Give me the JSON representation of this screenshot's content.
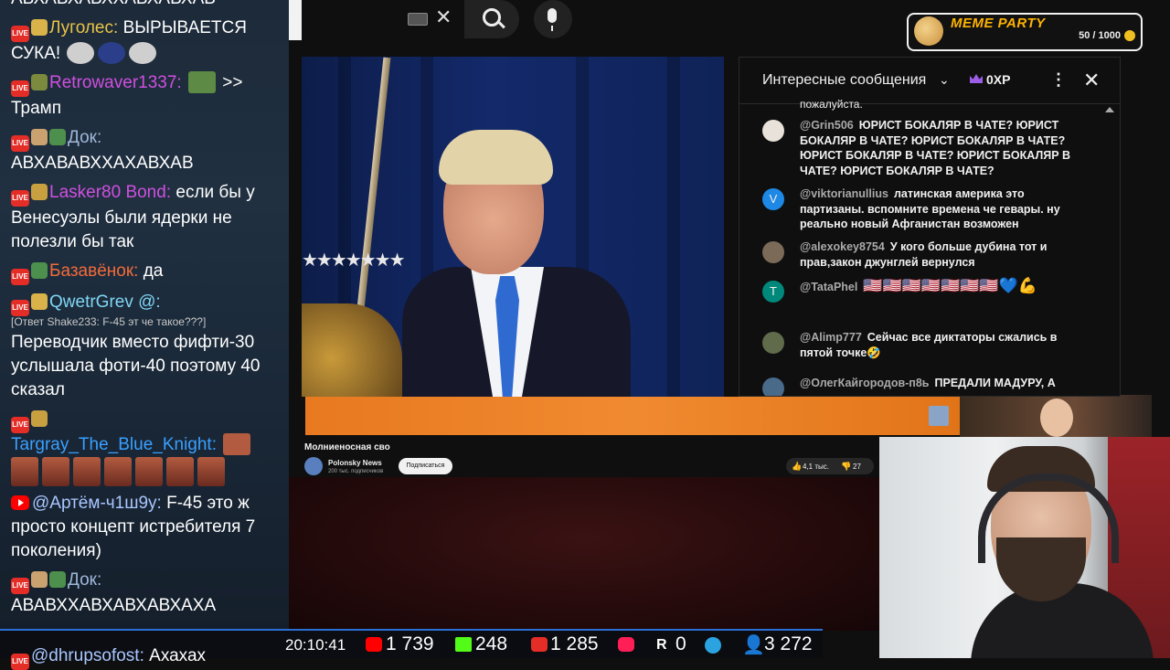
{
  "stream_chat": {
    "top_clipped": "АВХАВХАВХХАВХАВХАВ",
    "messages": [
      {
        "nick": "Луголес:",
        "nick_color": "#e8c547",
        "text": "ВЫРЫВАЕТСЯ СУКА!"
      },
      {
        "nick": "Retrowaver1337:",
        "nick_color": "#d04fe0",
        "text": ">> Трамп"
      },
      {
        "nick": "Док:",
        "nick_color": "#9fb7d8",
        "text": "АВХАВАВХХАХАВХАВ"
      },
      {
        "nick": "Lasker80 Bond:",
        "nick_color": "#d04fe0",
        "text": "если бы у Венесуэлы были ядерки не полезли бы так"
      },
      {
        "nick": "Базавёнок:",
        "nick_color": "#f36b3a",
        "text": "да"
      },
      {
        "nick": "QwetrGrev",
        "nick_color": "#7fd6f4",
        "text": "@:"
      },
      {
        "reply": "[Ответ Shake233: F-45 эт че такое???]",
        "text": "Переводчик вместо фифти-30 услышала фоти-40 поэтому 40 сказал"
      },
      {
        "nick": "Targray_The_Blue_Knight:",
        "nick_color": "#3aa0ff",
        "text": ""
      },
      {
        "nick": "@Артём-ч1ш9у:",
        "nick_color": "#a9c6ff",
        "text": "F-45 это ж просто концепт истребителя 7 поколения)"
      },
      {
        "nick": "Док:",
        "nick_color": "#9fb7d8",
        "text": "АВАВХХАВХАВХАВХАХА"
      }
    ],
    "bottom_clipped_nick": "@dhrupsofost:",
    "bottom_clipped_text": "Ахахах"
  },
  "yt_header": {
    "clear_label": "✕"
  },
  "meme_party": {
    "title": "MEME PARTY",
    "score": "50 / 1000"
  },
  "video": {
    "title": "Молниеносная сво",
    "channel": "Polonsky News",
    "subscribers": "200 тыс. подписчиков",
    "subscribe_label": "Подписаться",
    "likes": "4,1 тыс.",
    "dislikes": "27"
  },
  "yt_chat": {
    "mode": "Интересные сообщения",
    "xp": "0XP",
    "clipped_top": "пожалуйста.",
    "messages": [
      {
        "author": "@Grin506",
        "text": "ЮРИСТ БОКАЛЯР В ЧАТЕ? ЮРИСТ БОКАЛЯР В ЧАТЕ? ЮРИСТ БОКАЛЯР В ЧАТЕ? ЮРИСТ БОКАЛЯР В ЧАТЕ? ЮРИСТ БОКАЛЯР В ЧАТЕ? ЮРИСТ БОКАЛЯР В ЧАТЕ?",
        "avatar": "#e9e2da",
        "initial": ""
      },
      {
        "author": "@viktorianullius",
        "text": "латинская америка это партизаны. вспомните времена че гевары. ну реально новый Афганистан возможен",
        "avatar": "#1e88e5",
        "initial": "V"
      },
      {
        "author": "@alexokey8754",
        "text": "У кого больше дубина тот и прав,закон джунглей вернулся",
        "avatar": "#7c6a58",
        "initial": ""
      },
      {
        "author": "@TataPhel",
        "text": "🇺🇸🇺🇸🇺🇸🇺🇸🇺🇸🇺🇸🇺🇸💙💪",
        "avatar": "#00897b",
        "initial": "T"
      },
      {
        "author": "@Alimp777",
        "text": "Сейчас все диктаторы сжались в пятой точке🤣",
        "avatar": "#5f6b4a",
        "initial": ""
      },
      {
        "author": "@ОлегКайгородов-п8ь",
        "text": "ПРЕДАЛИ МАДУРУ, А",
        "avatar": "#4a6a8a",
        "initial": ""
      }
    ]
  },
  "stats": {
    "clock": "20:10:41",
    "youtube": "1 739",
    "kick": "248",
    "vk": "1 285",
    "rutube": "0",
    "telegram": "",
    "viewers": "3 272"
  }
}
